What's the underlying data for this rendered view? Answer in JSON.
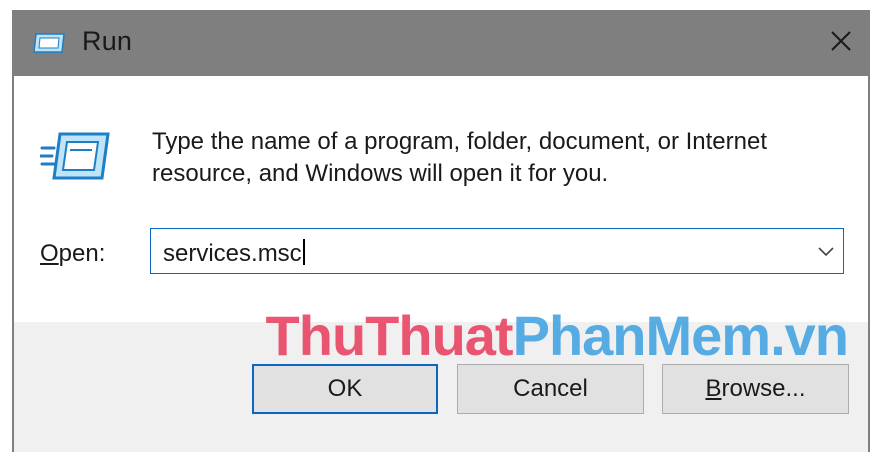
{
  "window": {
    "title": "Run",
    "close_glyph": "✕"
  },
  "icons": {
    "title": "run-icon",
    "main": "run-icon",
    "close": "close-icon",
    "dropdown": "chevron-down-icon"
  },
  "colors": {
    "titlebar": "#7f7f7f",
    "focus_border": "#0a66c2",
    "button_face": "#e1e1e1",
    "watermark_red": "#e8395a",
    "watermark_blue": "#3b9fe0"
  },
  "dialog": {
    "description_line1": "Type the name of a program, folder, document, or Internet",
    "description_line2": "resource, and Windows will open it for you.",
    "open_label_mnemonic": "O",
    "open_label_rest": "pen:",
    "input_value": "services.msc"
  },
  "buttons": {
    "ok": "OK",
    "cancel": "Cancel",
    "browse_mnemonic": "B",
    "browse_rest": "rowse..."
  },
  "watermark": {
    "part1": "ThuThuat",
    "part2": "PhanMem.vn"
  }
}
